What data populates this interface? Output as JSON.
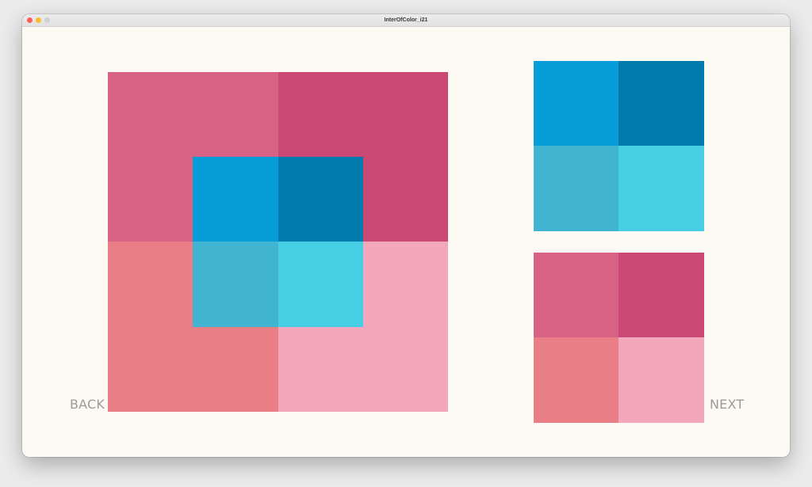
{
  "window": {
    "title": "InterOfColor_i21"
  },
  "colors": {
    "window_bg": "#fdf9f3",
    "close": "#fe5f57",
    "minimize": "#febc2e",
    "maximize": "#d0d0d0",
    "pink_a": "#d86283",
    "pink_b": "#cb4874",
    "pink_c": "#e97e87",
    "pink_d": "#f2a8ba",
    "blue_a": "#069dd8",
    "blue_b": "#037aad",
    "blue_c": "#40b4d1",
    "blue_d": "#46cee4"
  },
  "nav": {
    "back_label": "BACK",
    "next_label": "NEXT"
  }
}
